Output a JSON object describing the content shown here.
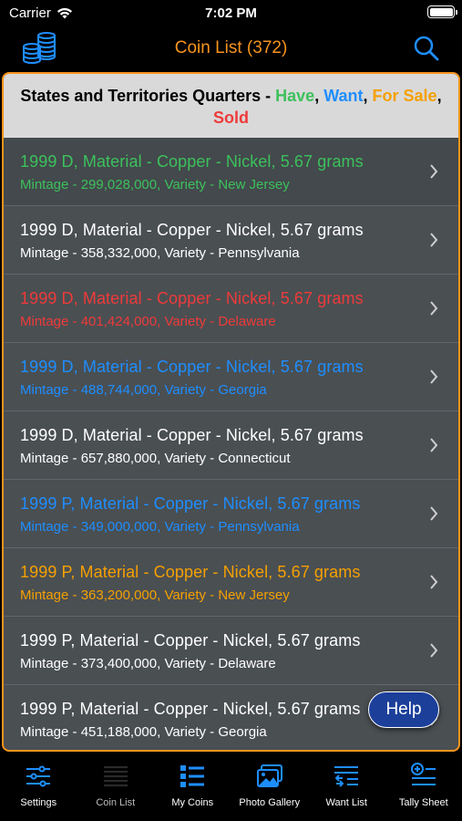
{
  "status_bar": {
    "carrier": "Carrier",
    "time": "7:02 PM"
  },
  "nav": {
    "title": "Coin List (372)",
    "left_icon": "coins-stack-icon",
    "right_icon": "search-icon"
  },
  "header": {
    "prefix": "States and Territories Quarters - ",
    "have": "Have",
    "sep1": ", ",
    "want": "Want",
    "sep2": ", ",
    "for_sale": "For Sale",
    "sep3": ", ",
    "sold": "Sold"
  },
  "colors": {
    "accent": "#f7941d",
    "have": "#3cc15c",
    "want": "#1e8eff",
    "for_sale": "#f5a000",
    "sold": "#ef3a3a",
    "default": "#ffffff"
  },
  "rows": [
    {
      "title": "1999 D, Material - Copper - Nickel, 5.67 grams",
      "subtitle": "Mintage - 299,028,000, Variety - New Jersey",
      "status": "have"
    },
    {
      "title": "1999 D, Material - Copper - Nickel, 5.67 grams",
      "subtitle": "Mintage - 358,332,000, Variety - Pennsylvania",
      "status": "none"
    },
    {
      "title": "1999 D, Material - Copper - Nickel, 5.67 grams",
      "subtitle": "Mintage - 401,424,000, Variety - Delaware",
      "status": "sold"
    },
    {
      "title": "1999 D, Material - Copper - Nickel, 5.67 grams",
      "subtitle": "Mintage - 488,744,000, Variety - Georgia",
      "status": "want"
    },
    {
      "title": "1999 D, Material - Copper - Nickel, 5.67 grams",
      "subtitle": "Mintage - 657,880,000, Variety - Connecticut",
      "status": "none"
    },
    {
      "title": "1999 P, Material - Copper - Nickel, 5.67 grams",
      "subtitle": "Mintage - 349,000,000, Variety - Pennsylvania",
      "status": "want"
    },
    {
      "title": "1999 P, Material - Copper - Nickel, 5.67 grams",
      "subtitle": "Mintage - 363,200,000, Variety - New Jersey",
      "status": "for_sale"
    },
    {
      "title": "1999 P, Material - Copper - Nickel, 5.67 grams",
      "subtitle": "Mintage - 373,400,000, Variety - Delaware",
      "status": "none"
    },
    {
      "title": "1999 P, Material - Copper - Nickel, 5.67 grams",
      "subtitle": "Mintage - 451,188,000, Variety - Georgia",
      "status": "none"
    }
  ],
  "help_button": "Help",
  "tabs": [
    {
      "label": "Settings",
      "icon": "sliders-icon"
    },
    {
      "label": "Coin List",
      "icon": "list-lines-icon"
    },
    {
      "label": "My Coins",
      "icon": "grid-list-icon"
    },
    {
      "label": "Photo Gallery",
      "icon": "photos-icon"
    },
    {
      "label": "Want List",
      "icon": "want-list-icon"
    },
    {
      "label": "Tally Sheet",
      "icon": "tally-sheet-icon"
    }
  ]
}
